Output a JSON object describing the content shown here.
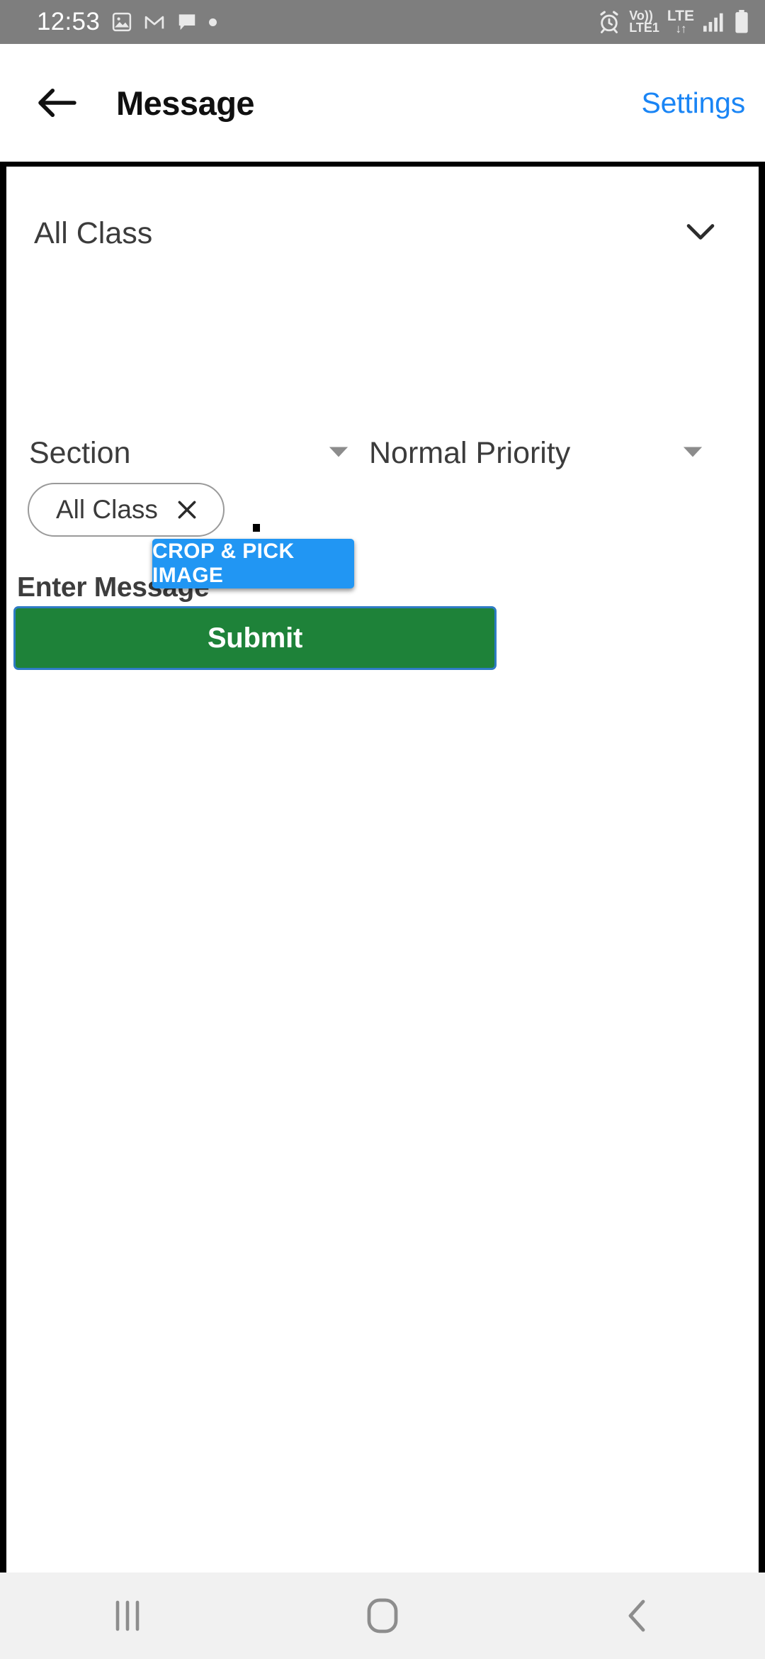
{
  "status_bar": {
    "time": "12:53",
    "icons": [
      "image-icon",
      "gmail-icon",
      "message-bubble-icon",
      "dot-icon"
    ],
    "volte_line1": "Vo))",
    "volte_line2": "LTE1",
    "lte_label": "LTE",
    "data_arrows": "↓↑",
    "right_icons": [
      "alarm-icon",
      "volte-icon",
      "lte-icon",
      "signal-icon",
      "battery-icon"
    ],
    "background": "#7e7e7e"
  },
  "app_bar": {
    "back_label": "Back",
    "title": "Message",
    "settings_label": "Settings",
    "settings_color": "#1a85f5"
  },
  "form": {
    "class_select": {
      "value": "All Class",
      "icon": "chevron-down-icon"
    },
    "chips": [
      {
        "label": "All Class",
        "remove_icon": "close-icon"
      }
    ],
    "section_select": {
      "value": "Section",
      "icon": "triangle-down-icon"
    },
    "priority_select": {
      "value": "Normal Priority",
      "icon": "triangle-down-icon"
    },
    "message_label": "Enter Message",
    "message_value": "",
    "message_placeholder": ""
  },
  "actions": {
    "crop_label": "CROP & PICK IMAGE",
    "crop_color": "#2196f3",
    "submit_label": "Submit",
    "submit_color": "#1e8239",
    "submit_border_color": "#2e7bc4"
  },
  "nav_bar": {
    "items": [
      {
        "name": "recents-icon"
      },
      {
        "name": "home-icon"
      },
      {
        "name": "back-icon"
      }
    ],
    "background": "#f1f1f1"
  }
}
